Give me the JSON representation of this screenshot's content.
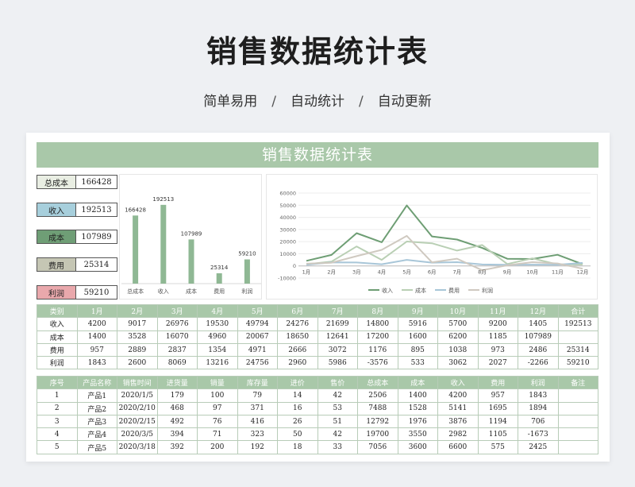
{
  "hero": {
    "title": "销售数据统计表",
    "tags": [
      "简单易用",
      "自动统计",
      "自动更新"
    ],
    "separator": "/"
  },
  "sheet": {
    "title": "销售数据统计表",
    "kpis": [
      {
        "label": "总成本",
        "value": "166428",
        "color": "#e9eee3"
      },
      {
        "label": "收入",
        "value": "192513",
        "color": "#a7cfdc"
      },
      {
        "label": "成本",
        "value": "107989",
        "color": "#6f9e76"
      },
      {
        "label": "费用",
        "value": "25314",
        "color": "#c5c6b4"
      },
      {
        "label": "利润",
        "value": "59210",
        "color": "#e9a8ac"
      }
    ],
    "summary": {
      "headers": [
        "类别",
        "1月",
        "2月",
        "3月",
        "4月",
        "5月",
        "6月",
        "7月",
        "8月",
        "9月",
        "10月",
        "11月",
        "12月",
        "合计"
      ],
      "rows": [
        [
          "收入",
          "4200",
          "9017",
          "26976",
          "19530",
          "49794",
          "24276",
          "21699",
          "14800",
          "5916",
          "5700",
          "9200",
          "1405",
          "192513"
        ],
        [
          "成本",
          "1400",
          "3528",
          "16070",
          "4960",
          "20067",
          "18650",
          "12641",
          "17200",
          "1600",
          "6200",
          "1185",
          "107989"
        ],
        [
          "费用",
          "957",
          "2889",
          "2837",
          "1354",
          "4971",
          "2666",
          "3072",
          "1176",
          "895",
          "1038",
          "973",
          "2486",
          "25314"
        ],
        [
          "利润",
          "1843",
          "2600",
          "8069",
          "13216",
          "24756",
          "2960",
          "5986",
          "-3576",
          "533",
          "3062",
          "2027",
          "-2266",
          "59210"
        ]
      ]
    },
    "detail": {
      "headers": [
        "序号",
        "产品名称",
        "销售时间",
        "进货量",
        "销量",
        "库存量",
        "进价",
        "售价",
        "总成本",
        "成本",
        "收入",
        "费用",
        "利润",
        "备注"
      ],
      "rows": [
        [
          "1",
          "产品1",
          "2020/1/5",
          "179",
          "100",
          "79",
          "14",
          "42",
          "2506",
          "1400",
          "4200",
          "957",
          "1843",
          ""
        ],
        [
          "2",
          "产品2",
          "2020/2/10",
          "468",
          "97",
          "371",
          "16",
          "53",
          "7488",
          "1528",
          "5141",
          "1695",
          "1894",
          ""
        ],
        [
          "3",
          "产品3",
          "2020/2/15",
          "492",
          "76",
          "416",
          "26",
          "51",
          "12792",
          "1976",
          "3876",
          "1194",
          "706",
          ""
        ],
        [
          "4",
          "产品4",
          "2020/3/5",
          "394",
          "71",
          "323",
          "50",
          "42",
          "19700",
          "3550",
          "2982",
          "1105",
          "-1673",
          ""
        ],
        [
          "5",
          "产品5",
          "2020/3/18",
          "392",
          "200",
          "192",
          "18",
          "33",
          "7056",
          "3600",
          "6600",
          "575",
          "2425",
          ""
        ]
      ]
    }
  },
  "chart_data": [
    {
      "type": "bar",
      "categories": [
        "总成本",
        "收入",
        "成本",
        "费用",
        "利润"
      ],
      "values": [
        166428,
        192513,
        107989,
        25314,
        59210
      ],
      "data_labels": [
        "166428",
        "192513",
        "107989",
        "25314",
        "59210"
      ],
      "ylim": [
        0,
        200000
      ],
      "color": "#8fb894",
      "grid": false
    },
    {
      "type": "line",
      "categories": [
        "1月",
        "2月",
        "3月",
        "4月",
        "5月",
        "6月",
        "7月",
        "8月",
        "9月",
        "10月",
        "11月",
        "12月"
      ],
      "yticks": [
        "60000",
        "50000",
        "40000",
        "30000",
        "20000",
        "10000",
        "0",
        "-10000"
      ],
      "ylim": [
        -10000,
        60000
      ],
      "grid": true,
      "legend_position": "bottom",
      "series": [
        {
          "name": "收入",
          "values": [
            4200,
            9017,
            26976,
            19530,
            49794,
            24276,
            21699,
            14800,
            5916,
            5700,
            9200,
            1405
          ],
          "color": "#6e9e74"
        },
        {
          "name": "成本",
          "values": [
            1400,
            3528,
            16070,
            4960,
            20067,
            18650,
            12641,
            17200,
            1600,
            6200,
            1185,
            1185
          ],
          "color": "#b9cfb4"
        },
        {
          "name": "费用",
          "values": [
            957,
            2889,
            2837,
            1354,
            4971,
            2666,
            3072,
            1176,
            895,
            1038,
            973,
            2486
          ],
          "color": "#a8c6d8"
        },
        {
          "name": "利润",
          "values": [
            1843,
            2600,
            8069,
            13216,
            24756,
            2960,
            5986,
            -3576,
            533,
            3062,
            2027,
            -2266
          ],
          "color": "#cfc9c0"
        }
      ]
    }
  ]
}
